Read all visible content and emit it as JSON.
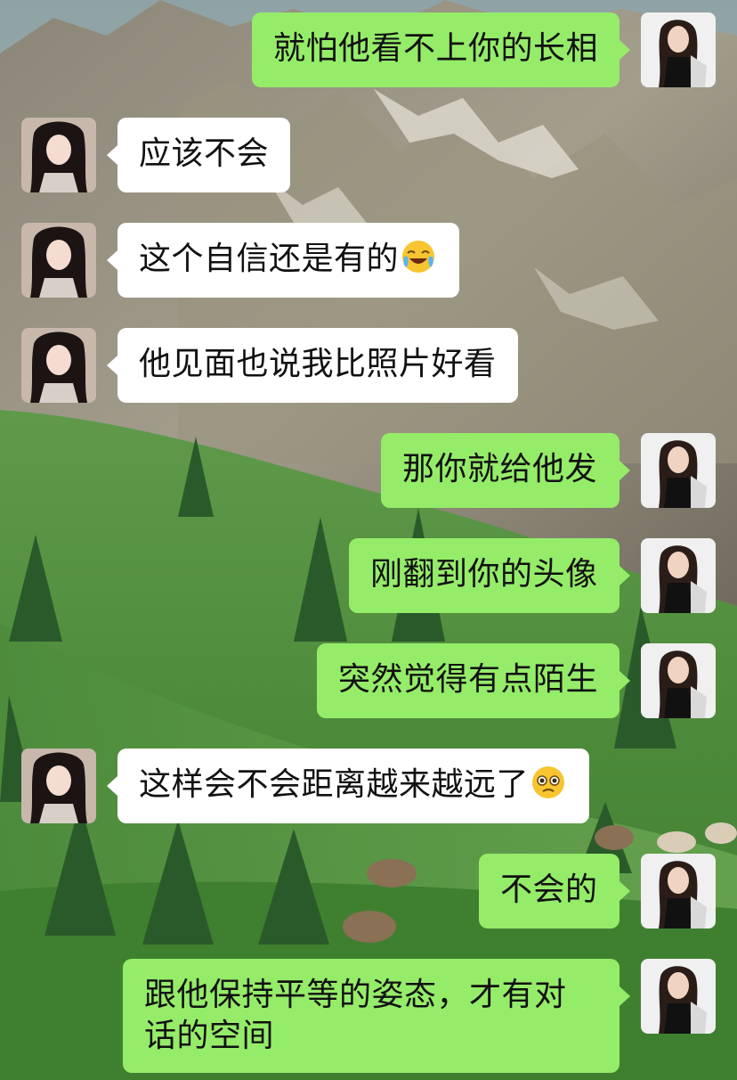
{
  "messages": [
    {
      "side": "self",
      "text": "就怕他看不上你的长相",
      "emoji": ""
    },
    {
      "side": "other",
      "text": "应该不会",
      "emoji": ""
    },
    {
      "side": "other",
      "text": "这个自信还是有的",
      "emoji": "laugh-cry-emoji"
    },
    {
      "side": "other",
      "text": "他见面也说我比照片好看",
      "emoji": ""
    },
    {
      "side": "self",
      "text": "那你就给他发",
      "emoji": ""
    },
    {
      "side": "self",
      "text": "刚翻到你的头像",
      "emoji": ""
    },
    {
      "side": "self",
      "text": "突然觉得有点陌生",
      "emoji": ""
    },
    {
      "side": "other",
      "text": "这样会不会距离越来越远了",
      "emoji": "pleading-face-emoji"
    },
    {
      "side": "self",
      "text": "不会的",
      "emoji": ""
    },
    {
      "side": "self",
      "text": "跟他保持平等的姿态，才有对话的空间",
      "emoji": ""
    }
  ],
  "colors": {
    "self_bubble": "#95ec69",
    "other_bubble": "#ffffff",
    "text": "#111111"
  }
}
